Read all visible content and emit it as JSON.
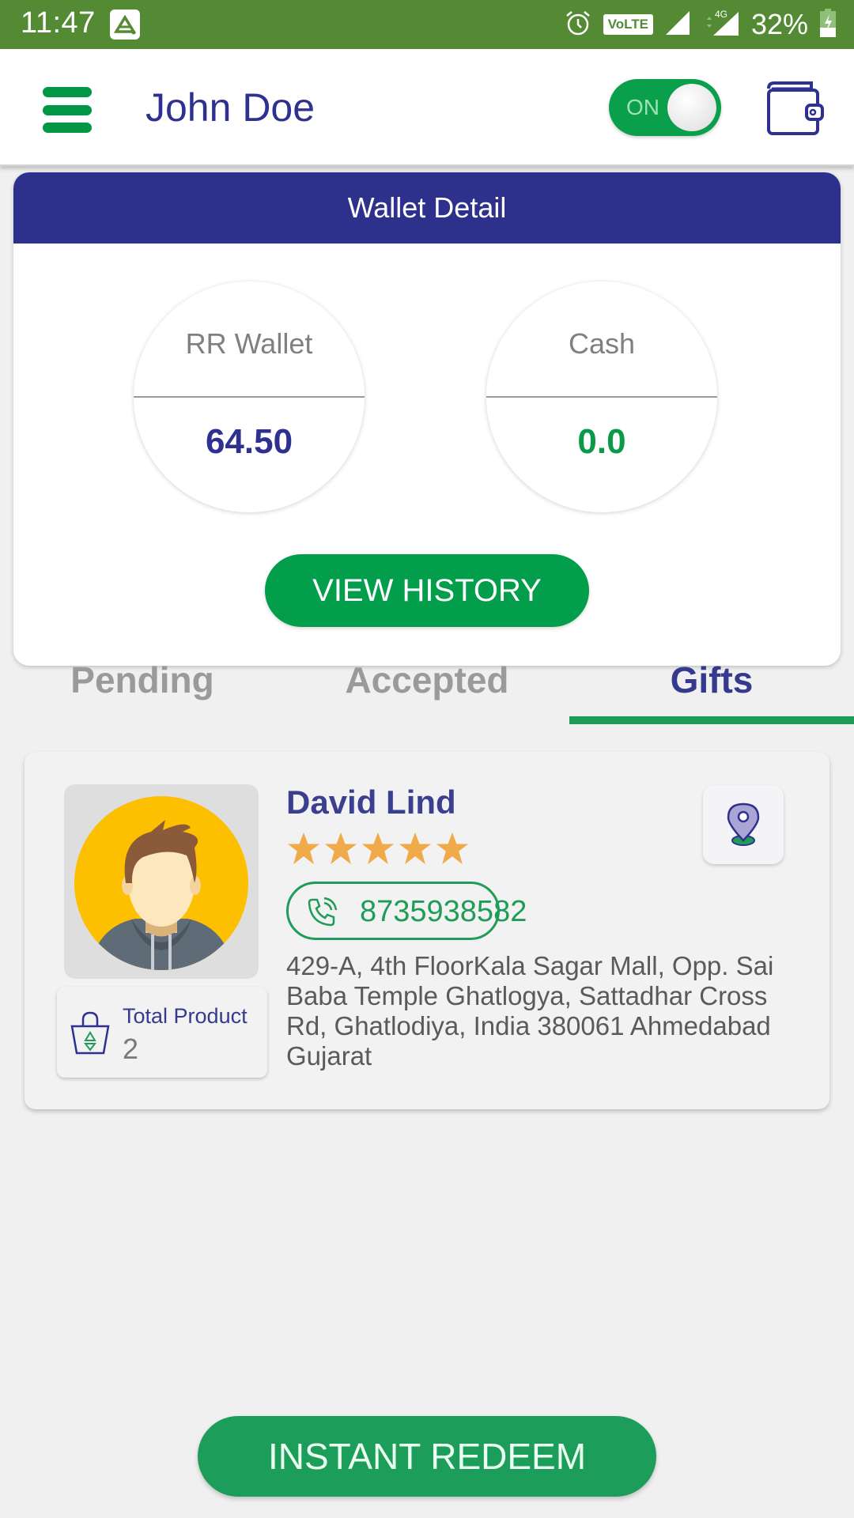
{
  "status_bar": {
    "time": "11:47",
    "volte": "VoLTE",
    "network": "4G",
    "battery": "32%"
  },
  "app_bar": {
    "title": "John Doe",
    "toggle_label": "ON",
    "toggle_state": "on"
  },
  "wallet": {
    "title": "Wallet Detail",
    "balances": [
      {
        "label": "RR Wallet",
        "value": "64.50"
      },
      {
        "label": "Cash",
        "value": "0.0"
      }
    ],
    "view_history_label": "VIEW HISTORY"
  },
  "tabs": [
    {
      "label": "Pending",
      "active": false
    },
    {
      "label": "Accepted",
      "active": false
    },
    {
      "label": "Gifts",
      "active": true
    }
  ],
  "order": {
    "customer_name": "David Lind",
    "rating": 5,
    "rating_max": 5,
    "phone": "8735938582",
    "address": "429-A, 4th FloorKala Sagar Mall,  Opp. Sai Baba Temple Ghatlogya,  Sattadhar Cross Rd,  Ghatlodiya,  India 380061 Ahmedabad Gujarat",
    "total_product_label": "Total Product",
    "total_product_value": "2"
  },
  "footer": {
    "redeem_label": "INSTANT REDEEM"
  },
  "colors": {
    "status_bar": "#548a34",
    "primary_green": "#029e4b",
    "navy": "#2e318c",
    "star": "#f0aa4a"
  }
}
